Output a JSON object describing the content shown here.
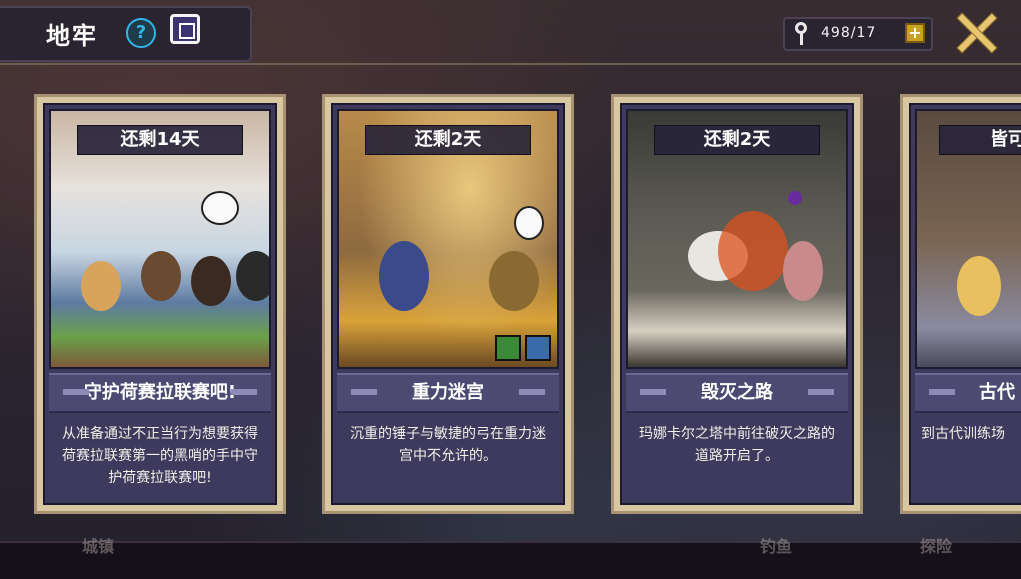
{
  "header": {
    "title": "地牢",
    "help_icon": "question-icon",
    "calendar_icon": "calendar-icon",
    "keys": "498/17",
    "add_label": "+"
  },
  "bottom_nav": [
    "城镇",
    "钓鱼",
    "探险"
  ],
  "cards": [
    {
      "timer": "还剩14天",
      "name": "守护荷赛拉联赛吧!",
      "desc": "从准备通过不正当行为想要获得荷赛拉联赛第一的黑哨的手中守护荷赛拉联赛吧!"
    },
    {
      "timer": "还剩2天",
      "name": "重力迷宫",
      "desc": "沉重的锤子与敏捷的弓在重力迷宫中不允许的。"
    },
    {
      "timer": "还剩2天",
      "name": "毁灭之路",
      "desc": "玛娜卡尔之塔中前往破灭之路的道路开启了。"
    },
    {
      "timer": "皆可",
      "name": "古代",
      "desc": "到古代训练场"
    }
  ],
  "colors": {
    "card_border": "#d8c7a1",
    "card_body": "#3d3a5e",
    "accent_gold": "#e6c670",
    "help_blue": "#2fb6e8"
  }
}
